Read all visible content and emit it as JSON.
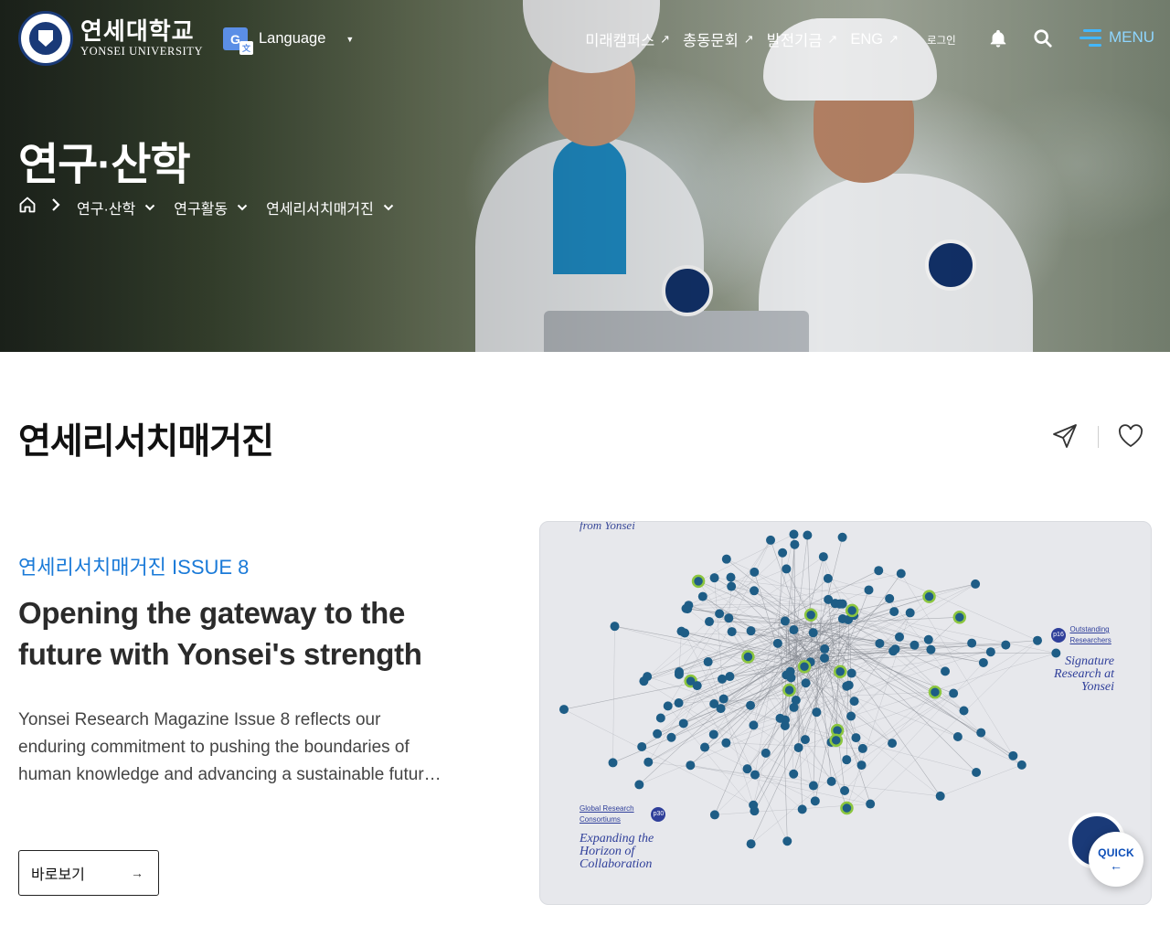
{
  "header": {
    "logo_ko": "연세대학교",
    "logo_en": "YONSEI UNIVERSITY",
    "language_label": "Language",
    "gnb": [
      {
        "label": "미래캠퍼스",
        "icon": "external-arrow-icon"
      },
      {
        "label": "총동문회",
        "icon": "external-arrow-icon"
      },
      {
        "label": "발전기금",
        "icon": "external-arrow-icon"
      },
      {
        "label": "ENG",
        "icon": "external-arrow-icon"
      }
    ],
    "login_label": "로그인",
    "menu_label": "MENU",
    "icons": {
      "bell": "bell-icon",
      "search": "search-icon",
      "menu": "hamburger-icon",
      "language": "translate-icon"
    }
  },
  "hero": {
    "title": "연구·산학",
    "breadcrumb": [
      "연구·산학",
      "연구활동",
      "연세리서치매거진"
    ]
  },
  "main": {
    "page_title": "연세리서치매거진",
    "issue_label": "연세리서치매거진 ISSUE 8",
    "headline": "Opening the gateway to the future with Yonsei's strength",
    "description": "Yonsei Research Magazine Issue 8 reflects our enduring commitment to pushing the boundaries of human knowledge and advancing a sustainable future for all.",
    "button_label": "바로보기"
  },
  "cover": {
    "top_text": "from Yonsei",
    "section1_title": "Outstanding Researchers",
    "section1_page": "p16",
    "section1_italic": "Signature Research at Yonsei",
    "section2_title": "Global Research Consortiums",
    "section2_page": "p30",
    "section2_italic": "Expanding the Horizon of Collaboration"
  },
  "quick": {
    "label": "QUICK"
  },
  "colors": {
    "accent": "#1a7ad8",
    "menu": "#43b7ff",
    "navy": "#1a3a78"
  }
}
